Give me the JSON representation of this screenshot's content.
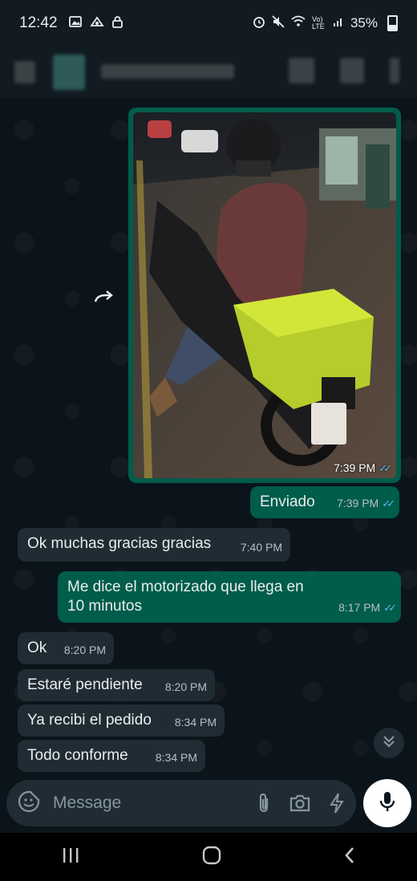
{
  "status": {
    "time": "12:42",
    "battery": "35%",
    "network": "Vo) LTE"
  },
  "messages": {
    "image": {
      "time": "7:39 PM"
    },
    "enviado": {
      "text": "Enviado",
      "time": "7:39 PM"
    },
    "ok_gracias": {
      "text": "Ok muchas gracias gracias",
      "time": "7:40 PM"
    },
    "motorizado": {
      "text": "Me dice el motorizado que llega en 10 minutos",
      "time": "8:17 PM"
    },
    "ok": {
      "text": "Ok",
      "time": "8:20 PM"
    },
    "pendiente": {
      "text": "Estaré pendiente",
      "time": "8:20 PM"
    },
    "recibi": {
      "text": "Ya recibi el pedido",
      "time": "8:34 PM"
    },
    "conforme": {
      "text": "Todo conforme",
      "time": "8:34 PM"
    }
  },
  "composer": {
    "placeholder": "Message"
  },
  "colors": {
    "incoming": "#202c33",
    "outgoing": "#005c4b",
    "read_ticks": "#53bdeb"
  },
  "icons": [
    "image-icon",
    "cloud-icon",
    "lock-icon",
    "alarm-icon",
    "mute-icon",
    "wifi-icon",
    "signal-icon",
    "forward-icon",
    "double-chevron-down-icon",
    "sticker-icon",
    "attach-icon",
    "camera-icon",
    "payment-icon",
    "mic-icon",
    "recent-apps-icon",
    "home-icon",
    "back-icon"
  ]
}
